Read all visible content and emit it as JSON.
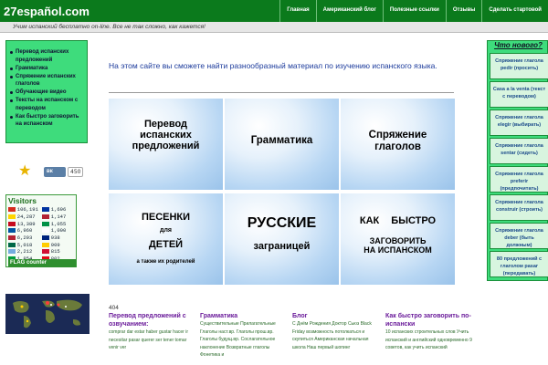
{
  "header": {
    "logo": "27español.com",
    "nav": [
      "Главная",
      "Американский блог",
      "Полезные ссылки",
      "Отзывы",
      "Сделать стартовой"
    ],
    "tagline": "Учим испанский бесплатно on-line. Все не так сложно, как кажется!"
  },
  "left_menu": {
    "items": [
      "Перевод испанских предложений",
      "Грамматика",
      "Спряжение испанских глаголов",
      "Обучающие видео",
      "Тексты на испанском с переводом",
      "Как быстро заговорить на испанском"
    ]
  },
  "social": {
    "vk_label": "вк",
    "vk_count": "450"
  },
  "visitors": {
    "title": "Visitors",
    "rows": [
      {
        "left": "106,191",
        "right": "1,696",
        "lc": "#d52b1e",
        "rc": "#0033a0"
      },
      {
        "left": "24,287",
        "right": "1,147",
        "lc": "#ffd500",
        "rc": "#b22234"
      },
      {
        "left": "13,389",
        "right": "1,055",
        "lc": "#c60b1e",
        "rc": "#009246"
      },
      {
        "left": "6,960",
        "right": "1,000",
        "lc": "#0055a4",
        "rc": "#ffffff"
      },
      {
        "left": "6,293",
        "right": "938",
        "lc": "#b22234",
        "rc": "#00247d"
      },
      {
        "left": "5,018",
        "right": "909",
        "lc": "#006847",
        "rc": "#ffcd00"
      },
      {
        "left": "2,212",
        "right": "815",
        "lc": "#74acdf",
        "rc": "#d21034"
      },
      {
        "left": "1,854",
        "right": "802",
        "lc": "#009c3b",
        "rc": "#e30a17"
      }
    ],
    "badge": "FLAG counter"
  },
  "main": {
    "intro": "На этом сайте вы сможете найти разнообразный материал по изучению испанского языка.",
    "tiles": [
      {
        "text": "Перевод испанских предложений"
      },
      {
        "text": "Грамматика"
      },
      {
        "text": "Спряжение глаголов"
      },
      {
        "line1": "ПЕСЕНКИ",
        "line2": "для",
        "line3": "ДЕТЕЙ",
        "line4": "а также их родителей"
      },
      {
        "line1": "РУССКИЕ",
        "line2": "заграницей"
      },
      {
        "line1": "КАК БЫСТРО",
        "line2": "ЗАГОВОРИТЬ НА ИСПАНСКОМ"
      }
    ],
    "counter": "404"
  },
  "bottom": [
    {
      "heading": "Перевод предложений с озвучанием:",
      "text": "comprar dar estar haber gustar hacer ir necesitar pasar querer ser tener tomar venir ver"
    },
    {
      "heading": "Грамматика",
      "text": "Существительные Прилагательные Глаголы наст.вр. Глаголы прош.вр. Глаголы будущ.вр. Сослагательное наклонение Возвратные глаголы Фонетика и"
    },
    {
      "heading": "Блог",
      "text": "С Днём Рождения Доктор Сьюз Black Friday возможность потолкаться и скупиться Американская начальная школа Наш первый шопинг"
    },
    {
      "heading": "Как быстро заговорить по-испански",
      "text": "10 испанских строительных слов Учить испанский и английский одновременно 9 советов, как учить испанский"
    }
  ],
  "right_box": {
    "title": "Что нового?",
    "items": [
      "Спряжение глагола pedir (просить)",
      "Casa a la venta (текст с переводом)",
      "Спряжение глагола elegir (выбирать)",
      "Спряжение глагола sentar (сидеть)",
      "Спряжение глагола preferir (предпочитать)",
      "Спряжение глагола construir (строить)",
      "Спряжение глагола deber (быть должным)",
      "80 предложений с глаголом pasar (передавать)"
    ]
  },
  "colors": {
    "brand_green": "#0b7a1c",
    "menu_green": "#3edc7c",
    "link_blue": "#1b3a9b"
  }
}
